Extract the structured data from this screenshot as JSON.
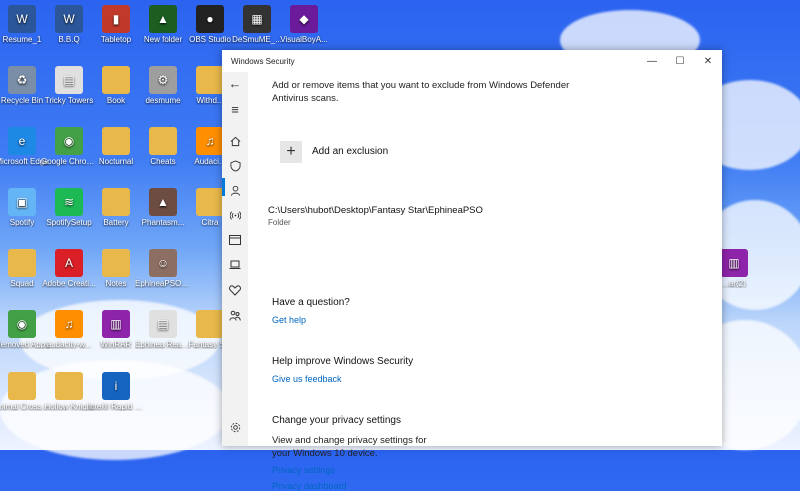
{
  "desktop": {
    "icons": [
      {
        "label": "Resume_1",
        "icon": "word-icon",
        "color": "#2b579a"
      },
      {
        "label": "B.B.Q",
        "icon": "word-icon",
        "color": "#2b579a"
      },
      {
        "label": "Tabletop",
        "icon": "book-icon",
        "color": "#c0392b"
      },
      {
        "label": "New folder",
        "icon": "app-icon",
        "color": "#1b5e20"
      },
      {
        "label": "OBS Studio",
        "icon": "obs-icon",
        "color": "#222222"
      },
      {
        "label": "DeSmuME_...",
        "icon": "emulator-icon",
        "color": "#333333"
      },
      {
        "label": "VisualBoyA...",
        "icon": "gba-icon",
        "color": "#6a1b9a"
      },
      {
        "label": "Recycle Bin",
        "icon": "recycle-bin-icon",
        "color": "#7a8ea8"
      },
      {
        "label": "Tricky Towers",
        "icon": "file-icon",
        "color": "#e0e0e0"
      },
      {
        "label": "Book",
        "icon": "folder-icon",
        "color": "#e8b84a"
      },
      {
        "label": "desmume",
        "icon": "settings-file-icon",
        "color": "#9e9e9e"
      },
      {
        "label": "Withd...",
        "icon": "folder-icon",
        "color": "#e8b84a"
      },
      {
        "label": "Microsoft Edge",
        "icon": "edge-icon",
        "color": "#1e88e5"
      },
      {
        "label": "Google Chrome",
        "icon": "chrome-icon",
        "color": "#43a047"
      },
      {
        "label": "Nocturnal",
        "icon": "folder-icon",
        "color": "#e8b84a"
      },
      {
        "label": "Cheats",
        "icon": "folder-icon",
        "color": "#e8b84a"
      },
      {
        "label": "Audaci...",
        "icon": "audacity-icon",
        "color": "#ff8f00"
      },
      {
        "label": "Spotify",
        "icon": "installer-icon",
        "color": "#64b5f6"
      },
      {
        "label": "SpotifySetup",
        "icon": "spotify-icon",
        "color": "#1db954"
      },
      {
        "label": "Battery",
        "icon": "folder-icon",
        "color": "#e8b84a"
      },
      {
        "label": "Phantasm...",
        "icon": "app-icon",
        "color": "#6d4c41"
      },
      {
        "label": "Citra",
        "icon": "folder-icon",
        "color": "#e8b84a"
      },
      {
        "label": "Squad",
        "icon": "folder-icon",
        "color": "#e8b84a"
      },
      {
        "label": "Adobe Creati...",
        "icon": "adobe-icon",
        "color": "#da1f26"
      },
      {
        "label": "Notes",
        "icon": "folder-icon",
        "color": "#e8b84a"
      },
      {
        "label": "EphineaPSOBB",
        "icon": "game-icon",
        "color": "#8d6e63"
      },
      {
        "label": "Removed Apps",
        "icon": "chrome-icon",
        "color": "#43a047"
      },
      {
        "label": "audacity-w...",
        "icon": "audacity-icon",
        "color": "#ff8f00"
      },
      {
        "label": "WinRAR",
        "icon": "winrar-icon",
        "color": "#8e24aa"
      },
      {
        "label": "Ephinea Readme",
        "icon": "file-icon",
        "color": "#e0e0e0"
      },
      {
        "label": "Fantasy S...",
        "icon": "folder-icon",
        "color": "#e8b84a"
      },
      {
        "label": "Animal Crossing",
        "icon": "folder-icon",
        "color": "#e8b84a"
      },
      {
        "label": "Hollow Knight",
        "icon": "folder-icon",
        "color": "#e8b84a"
      },
      {
        "label": "Intel® Rapid Storage Te...",
        "icon": "intel-icon",
        "color": "#1565c0"
      },
      {
        "label": "...ar(2)",
        "icon": "winrar-icon",
        "color": "#8e24aa"
      }
    ]
  },
  "window": {
    "title": "Windows Security",
    "minimize": "—",
    "maximize": "☐",
    "close": "✕"
  },
  "sidebar": {
    "back": "←",
    "menu": "≡",
    "items": [
      "home-icon",
      "shield-icon",
      "person-icon",
      "wifi-icon",
      "app-browser-icon",
      "laptop-icon",
      "heart-icon",
      "family-icon"
    ],
    "settings": "settings-icon"
  },
  "content": {
    "description": "Add or remove items that you want to exclude from Windows Defender Antivirus scans.",
    "add_exclusion": "Add an exclusion",
    "add_symbol": "+",
    "exclusion_path": "C:\\Users\\hubot\\Desktop\\Fantasy Star\\EphineaPSO",
    "exclusion_type": "Folder",
    "question_heading": "Have a question?",
    "get_help": "Get help",
    "improve_heading": "Help improve Windows Security",
    "feedback": "Give us feedback",
    "privacy_heading": "Change your privacy settings",
    "privacy_text": "View and change privacy settings for your Windows 10 device.",
    "privacy_settings": "Privacy settings",
    "privacy_dashboard": "Privacy dashboard"
  },
  "colors": {
    "accent": "#0078d7",
    "link": "#0067c0"
  }
}
